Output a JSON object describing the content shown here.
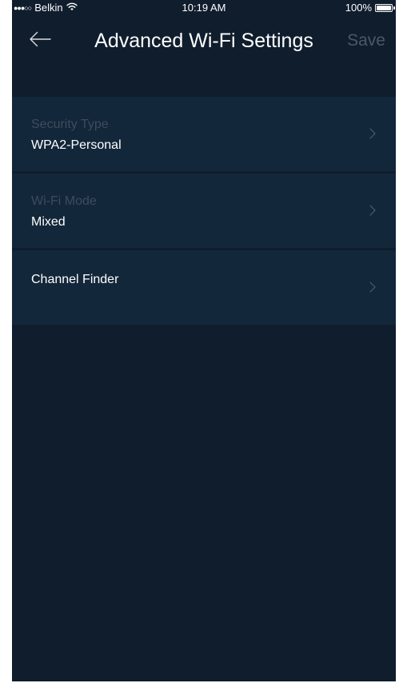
{
  "status_bar": {
    "signal": "●●●○○",
    "carrier": "Belkin",
    "wifi_icon": "wifi-icon",
    "time": "10:19 AM",
    "battery_text": "100%",
    "battery_level": 1.0
  },
  "nav": {
    "back_icon": "back-arrow-icon",
    "title": "Advanced Wi-Fi Settings",
    "save_label": "Save"
  },
  "settings": {
    "security_type": {
      "label": "Security Type",
      "value": "WPA2-Personal"
    },
    "wifi_mode": {
      "label": "Wi-Fi Mode",
      "value": "Mixed"
    },
    "channel_finder": {
      "value": "Channel Finder"
    }
  },
  "colors": {
    "background": "#0f1d2d",
    "row_background": "#13273a",
    "muted_label": "#3c4c5c",
    "disabled_action": "#4a5868",
    "text": "#ffffff"
  }
}
